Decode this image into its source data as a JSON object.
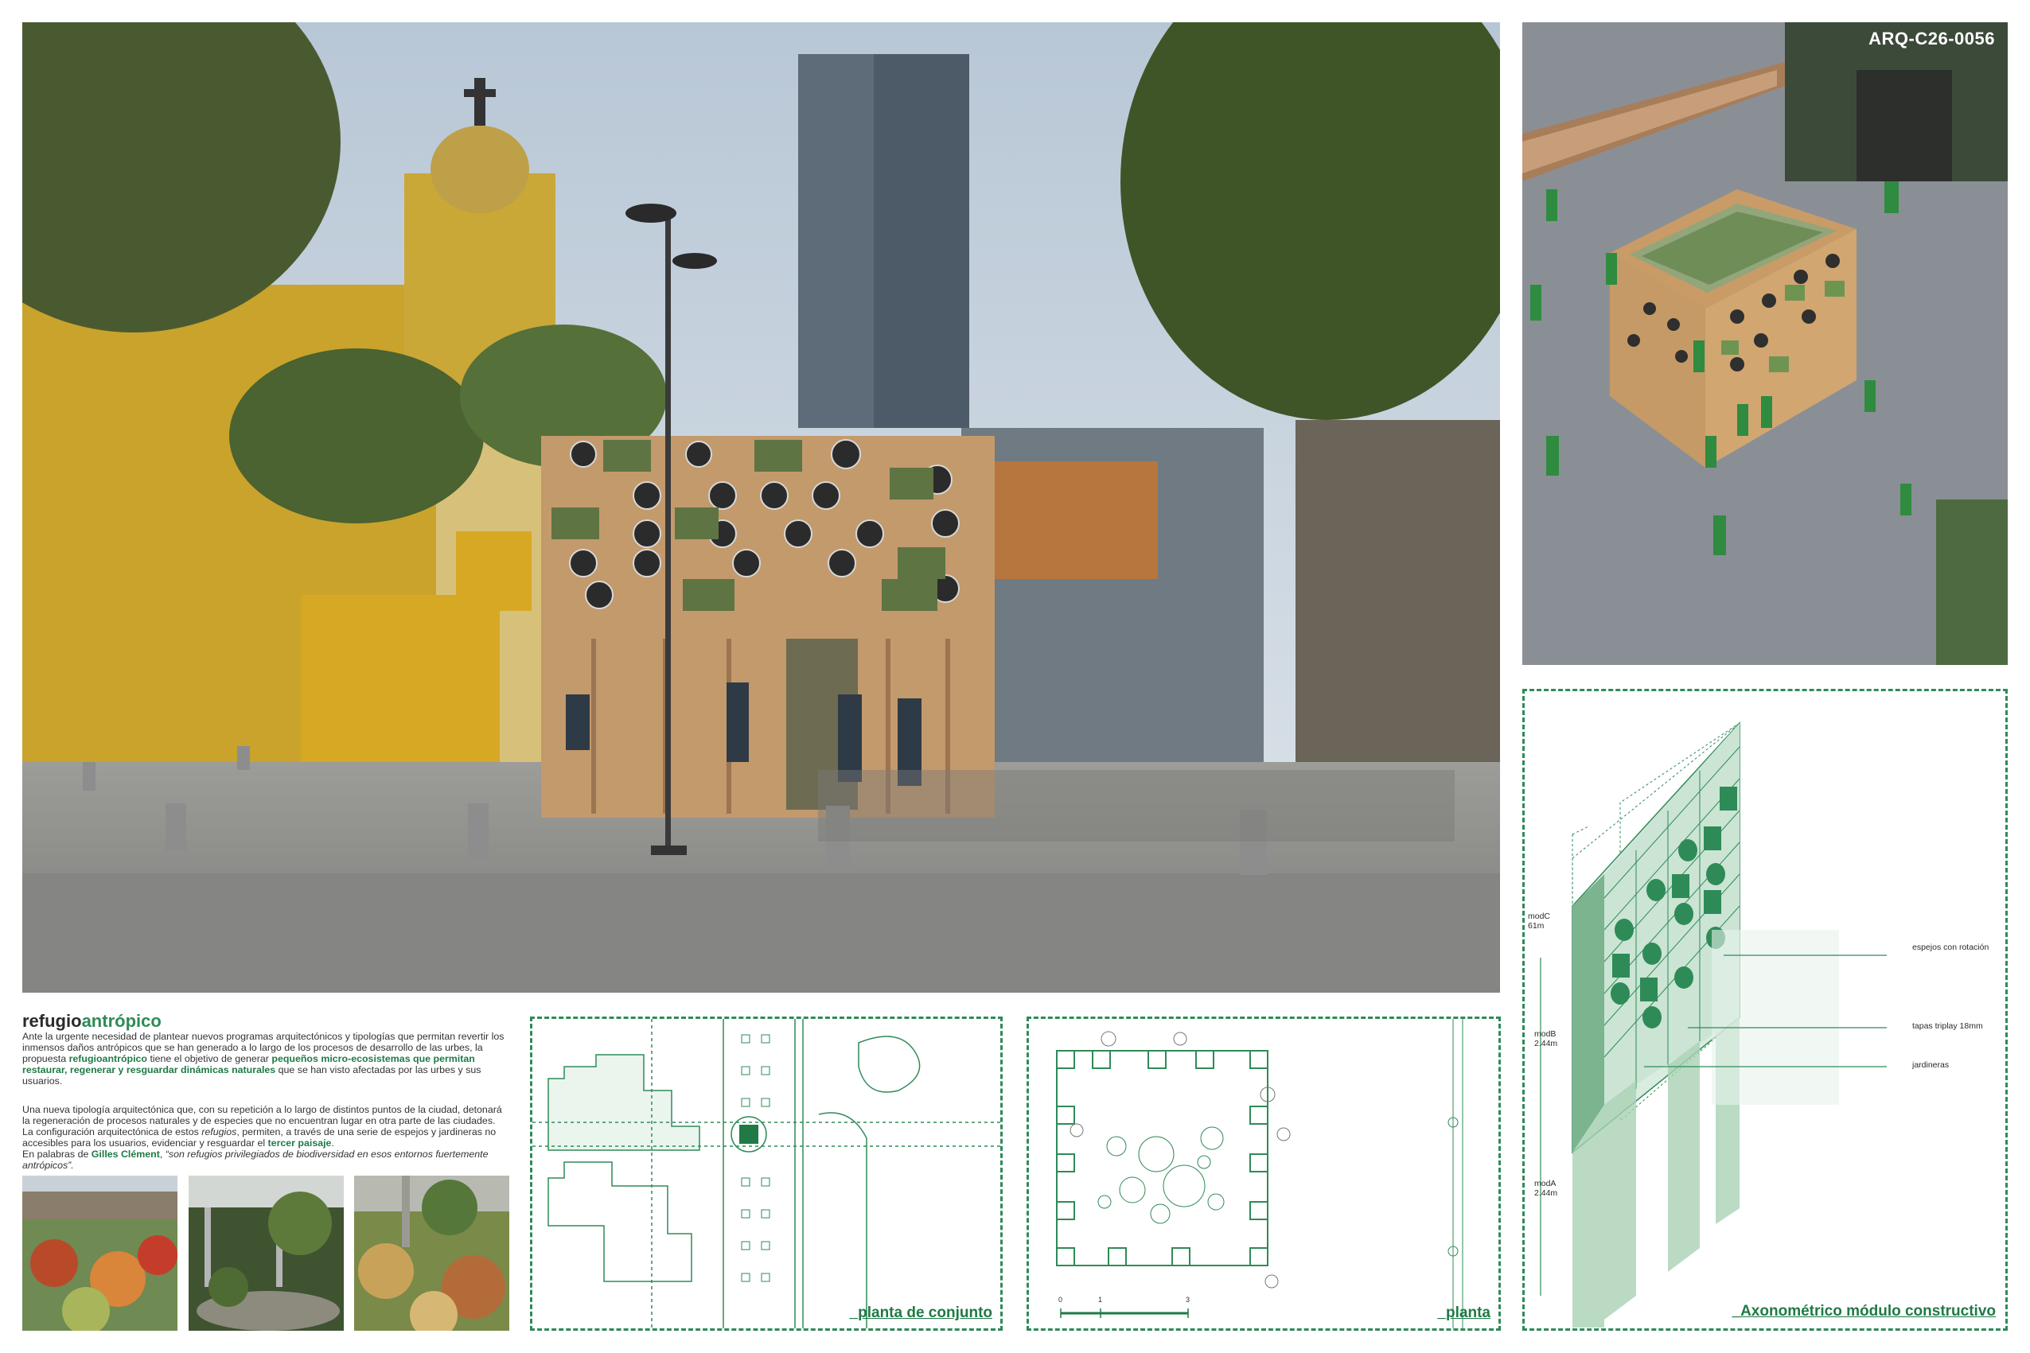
{
  "project_code": "ARQ-C26-0056",
  "title": {
    "part1": "refugio",
    "part2": "antrópico"
  },
  "intro": {
    "p1_a": "Ante la urgente necesidad de plantear nuevos programas arquitectónicos y tipologías que permitan revertir los inmensos daños antrópicos que se han generado a lo largo de los procesos de desarrollo de las urbes, la propuesta ",
    "p1_b": "refugioantrópico",
    "p1_c": " tiene el objetivo de generar ",
    "p1_d": "pequeños micro-ecosistemas que permitan restaurar, regenerar y resguardar dinámicas naturales",
    "p1_e": " que se han visto afectadas por las urbes y sus usuarios.",
    "p2_a": "Una nueva tipología arquitectónica que, con su repetición a lo largo de distintos puntos de la ciudad, detonará la regeneración de procesos naturales y de especies que no encuentran lugar en otra parte de las ciudades. La configuración arquitectónica de estos ",
    "p2_b": "refugios",
    "p2_c": ", permiten, a través de una serie de espejos y jardineras no accesibles para los usuarios, evidenciar y resguardar el ",
    "p2_d": "tercer paisaje",
    "p2_e": ".",
    "p2_f": "En palabras de ",
    "p2_g": "Gilles Clément",
    "p2_h": ", ",
    "p2_i": "“son refugios privilegiados de biodiversidad en esos entornos fuertemente antrópicos”."
  },
  "panels": {
    "site_plan": "_planta de conjunto",
    "plan": "_planta",
    "axo": "_Axonométrico módulo constructivo"
  },
  "scale": {
    "t0": "0",
    "t1": "1",
    "t3": "3"
  },
  "axo_labels": {
    "mirrors": "espejos con rotación",
    "covers": "tapas triplay 18mm",
    "planters": "jardineras",
    "modC": "modC",
    "modC_dim": "61m",
    "modB": "modB",
    "modB_dim": "2.44m",
    "modA": "modA",
    "modA_dim": "2.44m"
  }
}
